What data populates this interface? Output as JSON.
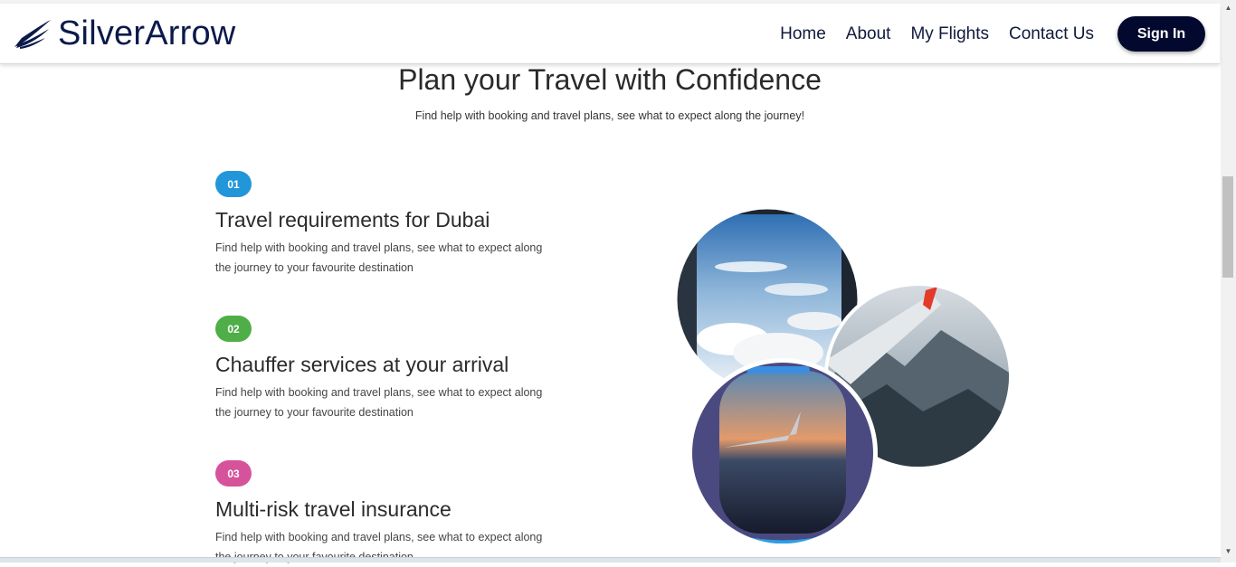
{
  "header": {
    "logo_text": "SilverArrow",
    "nav": [
      {
        "label": "Home"
      },
      {
        "label": "About"
      },
      {
        "label": "My Flights"
      },
      {
        "label": "Contact Us"
      }
    ],
    "signin_label": "Sign In"
  },
  "section": {
    "title": "Plan your Travel with Confidence",
    "subtitle": "Find help with booking and travel plans, see what to expect along the journey!"
  },
  "features": [
    {
      "number": "01",
      "color": "#2196d8",
      "title": "Travel requirements for Dubai",
      "desc": "Find help with booking and travel plans, see what to expect along the journey to your favourite destination"
    },
    {
      "number": "02",
      "color": "#4fae47",
      "title": "Chauffer services at your arrival",
      "desc": "Find help with booking and travel plans, see what to expect along the journey to your favourite destination"
    },
    {
      "number": "03",
      "color": "#d6539b",
      "title": "Multi-risk travel insurance",
      "desc": "Find help with booking and travel plans, see what to expect along the journey to your favourite destination"
    }
  ],
  "icons": {
    "logo": "wing-logo-icon",
    "scroll_up": "scroll-up-arrow-icon",
    "scroll_down": "scroll-down-arrow-icon"
  },
  "images": [
    "airplane-window-clouds-photo",
    "airplane-wing-mountains-photo",
    "airplane-window-sunset-photo"
  ]
}
